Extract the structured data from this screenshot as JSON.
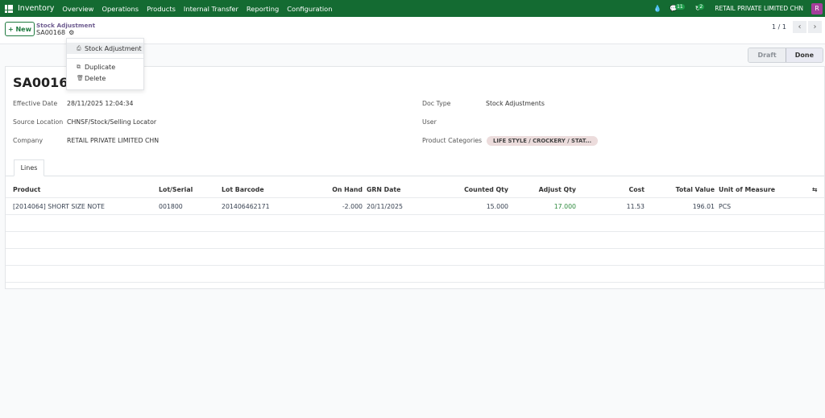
{
  "topbar": {
    "app": "Inventory",
    "menus": [
      "Overview",
      "Operations",
      "Products",
      "Internal Transfer",
      "Reporting",
      "Configuration"
    ],
    "messages_count": "11",
    "activities_count": "2",
    "company": "RETAIL PRIVATE LIMITED CHN",
    "avatar": "R"
  },
  "control": {
    "new_label": "New",
    "breadcrumb_parent": "Stock Adjustment",
    "breadcrumb_current": "SA00168",
    "pager": "1 / 1"
  },
  "dropdown": {
    "print": "Stock Adjustment",
    "duplicate": "Duplicate",
    "delete": "Delete"
  },
  "status": {
    "draft": "Draft",
    "done": "Done"
  },
  "form": {
    "title": "SA00168",
    "effective_date_label": "Effective Date",
    "effective_date": "28/11/2025 12:04:34",
    "source_location_label": "Source Location",
    "source_location": "CHNSF/Stock/Selling Locator",
    "company_label": "Company",
    "company": "RETAIL PRIVATE LIMITED CHN",
    "doc_type_label": "Doc Type",
    "doc_type": "Stock Adjustments",
    "user_label": "User",
    "product_categories_label": "Product Categories",
    "product_category_tag": "LIFE STYLE / CROCKERY / STAT..."
  },
  "tabs": {
    "lines": "Lines"
  },
  "table": {
    "headers": {
      "product": "Product",
      "lot": "Lot/Serial",
      "barcode": "Lot Barcode",
      "onhand": "On Hand",
      "grn": "GRN Date",
      "counted": "Counted Qty",
      "adjust": "Adjust Qty",
      "cost": "Cost",
      "total": "Total Value",
      "uom": "Unit of Measure"
    },
    "rows": [
      {
        "product": "[2014064] SHORT SIZE NOTE",
        "lot": "001800",
        "barcode": "201406462171",
        "onhand": "-2.000",
        "grn": "20/11/2025",
        "counted": "15.000",
        "adjust": "17.000",
        "cost": "11.53",
        "total": "196.01",
        "uom": "PCS"
      }
    ]
  },
  "colors": {
    "topbar": "#146b32",
    "adjust_qty": "#2e8b3e"
  }
}
